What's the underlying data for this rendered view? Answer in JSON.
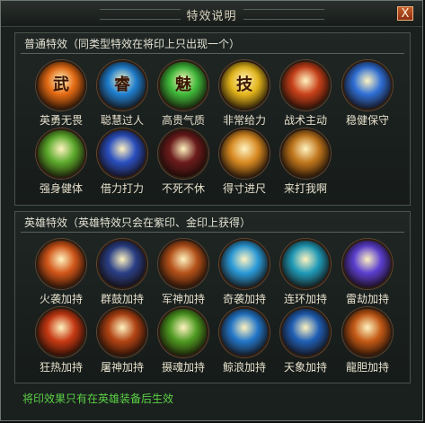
{
  "window": {
    "title": "特效说明",
    "close_label": "X"
  },
  "normal_section": {
    "title": "普通特效（同类型特效在将印上只出现一个）",
    "skills": [
      {
        "label": "英勇无畏",
        "glyph": "武",
        "icon": "wu-seal-icon",
        "color": "#e46b14"
      },
      {
        "label": "聪慧过人",
        "glyph": "睿",
        "icon": "rui-seal-icon",
        "color": "#1f7fcf"
      },
      {
        "label": "高贵气质",
        "glyph": "魅",
        "icon": "mei-seal-icon",
        "color": "#3fb93a"
      },
      {
        "label": "非常给力",
        "glyph": "技",
        "icon": "ji-seal-icon",
        "color": "#e4b61c"
      },
      {
        "label": "战术主动",
        "glyph": "",
        "icon": "flaming-sword-icon",
        "color": "#c8411a"
      },
      {
        "label": "稳健保守",
        "glyph": "",
        "icon": "blue-shield-icon",
        "color": "#2f6fd6"
      },
      {
        "label": "强身健体",
        "glyph": "",
        "icon": "green-bell-icon",
        "color": "#5caa2c"
      },
      {
        "label": "借力打力",
        "glyph": "",
        "icon": "blue-fighter-icon",
        "color": "#2a4fbf"
      },
      {
        "label": "不死不休",
        "glyph": "",
        "icon": "bone-icon",
        "color": "#6b1c1c"
      },
      {
        "label": "得寸进尺",
        "glyph": "",
        "icon": "fist-icon",
        "color": "#d88a22"
      },
      {
        "label": "来打我啊",
        "glyph": "",
        "icon": "monk-icon",
        "color": "#c0761c"
      }
    ]
  },
  "hero_section": {
    "title": "英雄特效（英雄特效只会在紫印、金印上获得）",
    "skills": [
      {
        "label": "火袭加持",
        "icon": "fire-rain-icon",
        "color": "#d2571a"
      },
      {
        "label": "群鼓加持",
        "icon": "blue-warriors-icon",
        "color": "#2a3f86"
      },
      {
        "label": "军神加持",
        "icon": "fire-warrior-icon",
        "color": "#b5521a"
      },
      {
        "label": "奇袭加持",
        "icon": "ice-burst-icon",
        "color": "#2a9ad8"
      },
      {
        "label": "连环加持",
        "icon": "vortex-icon",
        "color": "#1f9ab8"
      },
      {
        "label": "雷劫加持",
        "icon": "lightning-icon",
        "color": "#5b3fd0"
      },
      {
        "label": "狂热加持",
        "icon": "fire-fighter-icon",
        "color": "#c73a14"
      },
      {
        "label": "屠神加持",
        "icon": "fire-demon-icon",
        "color": "#b24414"
      },
      {
        "label": "摄魂加持",
        "icon": "green-skull-icon",
        "color": "#4e9a22"
      },
      {
        "label": "鲸浪加持",
        "icon": "wave-icon",
        "color": "#2276c8"
      },
      {
        "label": "天象加持",
        "icon": "blue-orb-icon",
        "color": "#1f5fb5"
      },
      {
        "label": "龍胆加持",
        "icon": "dragon-warrior-icon",
        "color": "#c45a16"
      }
    ]
  },
  "footer": {
    "note": "将印效果只有在英雄装备后生效"
  }
}
